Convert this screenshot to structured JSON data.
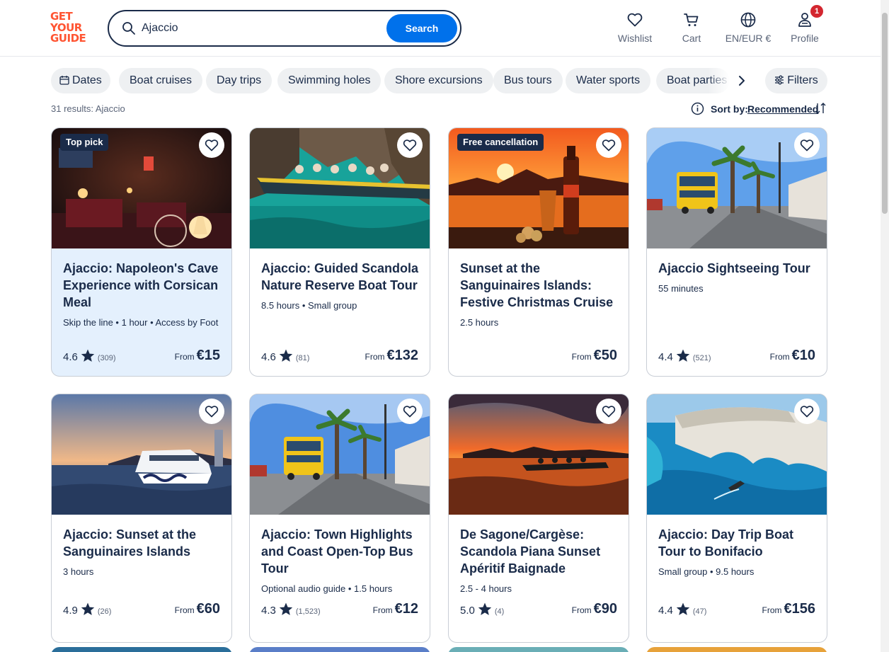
{
  "logo": {
    "line1": "GET",
    "line2": "YOUR",
    "line3": "GUIDE",
    "color": "#ff5533"
  },
  "search": {
    "value": "Ajaccio",
    "placeholder": "Search",
    "button_label": "Search"
  },
  "nav": {
    "wishlist": "Wishlist",
    "cart": "Cart",
    "language": "EN/EUR €",
    "profile": "Profile",
    "profile_badge": "1"
  },
  "chips": [
    "Dates",
    "Boat cruises",
    "Day trips",
    "Swimming holes",
    "Shore excursions",
    "Bus tours",
    "Water sports",
    "Boat parties"
  ],
  "filters_label": "Filters",
  "results_text": "31 results: Ajaccio",
  "sort": {
    "label": "Sort by:",
    "value": "Recommended"
  },
  "colors": {
    "primary": "#0071eb",
    "text": "#1a2b49",
    "selected_card": "#e4f0fd",
    "badge": "#d3262f"
  },
  "cards": [
    {
      "tag": "Top pick",
      "title": "Ajaccio: Napoleon's Cave Experience with Corsican Meal",
      "meta": "Skip the line • 1 hour • Access by Foot",
      "rating": "4.6",
      "reviews": "(309)",
      "from": "From",
      "price": "€15"
    },
    {
      "tag": "",
      "title": "Ajaccio: Guided Scandola Nature Reserve Boat Tour",
      "meta": "8.5 hours • Small group",
      "rating": "4.6",
      "reviews": "(81)",
      "from": "From",
      "price": "€132"
    },
    {
      "tag": "Free cancellation",
      "title": "Sunset at the Sanguinaires Islands: Festive Christmas Cruise",
      "meta": "2.5 hours",
      "rating": "",
      "reviews": "",
      "from": "From",
      "price": "€50"
    },
    {
      "tag": "",
      "title": "Ajaccio Sightseeing Tour",
      "meta": "55 minutes",
      "rating": "4.4",
      "reviews": "(521)",
      "from": "From",
      "price": "€10"
    },
    {
      "tag": "",
      "title": "Ajaccio: Sunset at the Sanguinaires Islands",
      "meta": "3 hours",
      "rating": "4.9",
      "reviews": "(26)",
      "from": "From",
      "price": "€60"
    },
    {
      "tag": "",
      "title": "Ajaccio: Town Highlights and Coast Open-Top Bus Tour",
      "meta": "Optional audio guide • 1.5 hours",
      "rating": "4.3",
      "reviews": "(1,523)",
      "from": "From",
      "price": "€12"
    },
    {
      "tag": "",
      "title": "De Sagone/Cargèse: Scandola Piana Sunset Apéritif Baignade",
      "meta": "2.5 - 4 hours",
      "rating": "5.0",
      "reviews": "(4)",
      "from": "From",
      "price": "€90"
    },
    {
      "tag": "",
      "title": "Ajaccio: Day Trip Boat Tour to Bonifacio",
      "meta": "Small group • 9.5 hours",
      "rating": "4.4",
      "reviews": "(47)",
      "from": "From",
      "price": "€156"
    }
  ]
}
